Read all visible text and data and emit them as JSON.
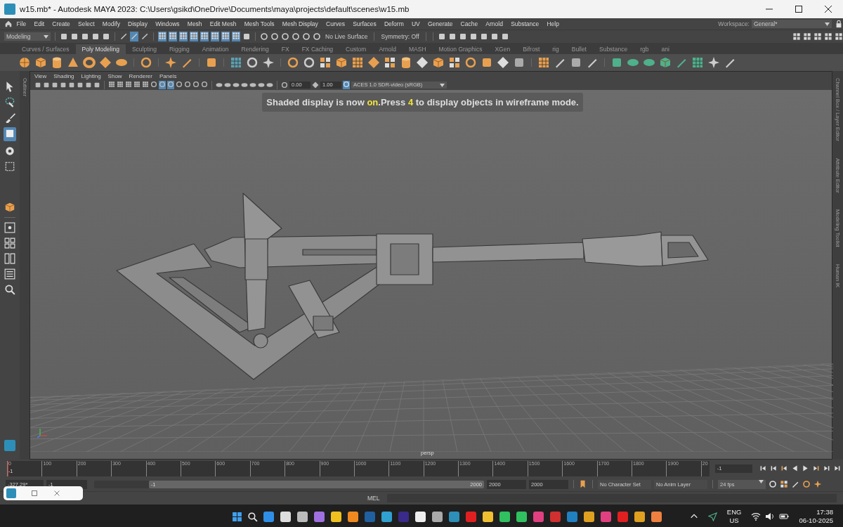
{
  "window": {
    "title": "w15.mb* - Autodesk MAYA 2023: C:\\Users\\gsikd\\OneDrive\\Documents\\maya\\projects\\default\\scenes\\w15.mb"
  },
  "menu_bar": {
    "items": [
      "File",
      "Edit",
      "Create",
      "Select",
      "Modify",
      "Display",
      "Windows",
      "Mesh",
      "Edit Mesh",
      "Mesh Tools",
      "Mesh Display",
      "Curves",
      "Surfaces",
      "Deform",
      "UV",
      "Generate",
      "Cache",
      "Arnold",
      "Substance",
      "Help"
    ],
    "workspace_label": "Workspace:",
    "workspace": "General*"
  },
  "status_line": {
    "mode": "Modeling",
    "live_surface": "No Live Surface",
    "symmetry": "Symmetry: Off"
  },
  "shelf_tabs": [
    {
      "label": "Curves / Surfaces",
      "selected": false
    },
    {
      "label": "Poly Modeling",
      "selected": true
    },
    {
      "label": "Sculpting",
      "selected": false
    },
    {
      "label": "Rigging",
      "selected": false
    },
    {
      "label": "Animation",
      "selected": false
    },
    {
      "label": "Rendering",
      "selected": false
    },
    {
      "label": "FX",
      "selected": false
    },
    {
      "label": "FX Caching",
      "selected": false
    },
    {
      "label": "Custom",
      "selected": false
    },
    {
      "label": "Arnold",
      "selected": false
    },
    {
      "label": "MASH",
      "selected": false
    },
    {
      "label": "Motion Graphics",
      "selected": false
    },
    {
      "label": "XGen",
      "selected": false
    },
    {
      "label": "Bifrost",
      "selected": false
    },
    {
      "label": "rig",
      "selected": false
    },
    {
      "label": "Bullet",
      "selected": false
    },
    {
      "label": "Substance",
      "selected": false
    },
    {
      "label": "rgb",
      "selected": false
    },
    {
      "label": "ani",
      "selected": false
    }
  ],
  "left_panel_tab": "Outliner",
  "viewport": {
    "menus": [
      "View",
      "Shading",
      "Lighting",
      "Show",
      "Renderer",
      "Panels"
    ],
    "exposure": "0.00",
    "gamma": "1.00",
    "color_space": "ACES 1.0 SDR-video (sRGB)",
    "hud_message": "Shaded display is now **on**.Press **4** to display objects in wireframe mode.",
    "camera": "persp"
  },
  "right_panel_tabs": [
    "Channel Box / Layer Editor",
    "Attribute Editor",
    "Modeling Toolkit",
    "Human IK"
  ],
  "timeline": {
    "ticks": [
      "0",
      "100",
      "200",
      "300",
      "400",
      "500",
      "600",
      "700",
      "800",
      "900",
      "1000",
      "1100",
      "1200",
      "1300",
      "1400",
      "1500",
      "1600",
      "1700",
      "1800",
      "1900",
      "20"
    ],
    "current_frame_marker": "-1",
    "current_frame": "-1",
    "level": 0
  },
  "range_slider": {
    "rotation": "-327.29*",
    "start": "-1",
    "range_start": "-1",
    "range_end": "2000",
    "anim_end": "2000",
    "end": "2000",
    "character_set": "No Character Set",
    "anim_layer": "No Anim Layer",
    "fps": "24 fps",
    "level": 0.86
  },
  "command_line": {
    "language": "MEL"
  },
  "taskbar": {
    "language": "ENG",
    "region": "US",
    "time": "17:38",
    "date": "06-10-2025"
  }
}
